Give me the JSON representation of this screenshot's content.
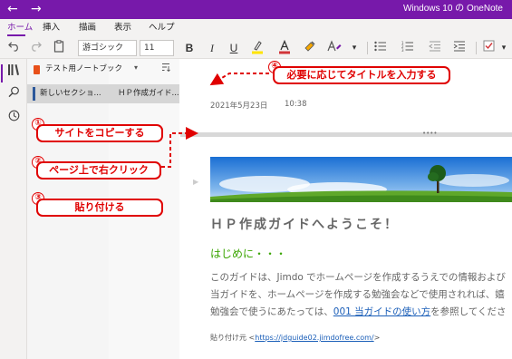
{
  "titlebar": {
    "back_icon": "←",
    "forward_icon": "→",
    "app_title": "Windows 10 の OneNote"
  },
  "menu": {
    "tabs": [
      "ホーム",
      "挿入",
      "描画",
      "表示",
      "ヘルプ"
    ]
  },
  "toolbar": {
    "font_name": "游ゴシック",
    "font_size": "11",
    "bold": "B",
    "italic": "I",
    "underline": "U"
  },
  "notebook": {
    "name": "テスト用ノートブック",
    "section": "新しいセクショ...",
    "page": "ＨＰ作成ガイド..."
  },
  "page": {
    "date": "2021年5月23日",
    "time": "10:38",
    "heading": "ＨＰ作成ガイドへようこそ！",
    "subheading": "はじめに・・・",
    "line1": "このガイドは、Jimdo でホームページを作成するうえでの情報および",
    "line2": "当ガイドを、ホームページを作成する勉強会などで使用されれば、嬉",
    "line3_pre": "勉強会で使うにあたっては、",
    "line3_link": "001 当ガイドの使い方",
    "line3_post": "を参照してくださ",
    "pasted_label": "貼り付け元",
    "pasted_open": "<",
    "pasted_url": "https://jdguide02.jimdofree.com/",
    "pasted_close": ">"
  },
  "annotations": {
    "step1": {
      "num": "①",
      "text": "サイトをコピーする"
    },
    "step2": {
      "num": "②",
      "text": "ページ上で右クリック"
    },
    "step3": {
      "num": "③",
      "text": "貼り付ける"
    },
    "step4": {
      "num": "④",
      "text": "必要に応じてタイトルを入力する"
    }
  },
  "colors": {
    "brand": "#7719aa",
    "annotation": "#e00000",
    "link": "#1a5eb8",
    "subheading": "#3aa500"
  }
}
